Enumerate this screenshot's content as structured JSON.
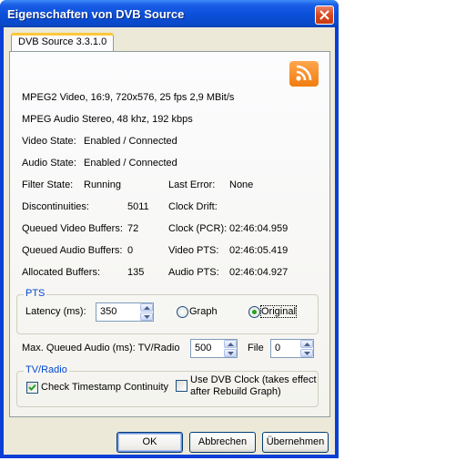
{
  "window": {
    "title": "Eigenschaften von DVB Source"
  },
  "tab": {
    "label": "DVB Source 3.3.1.0"
  },
  "info": {
    "video_format": "MPEG2 Video, 16:9, 720x576, 25 fps  2,9 MBit/s",
    "audio_format": "MPEG Audio Stereo, 48 khz, 192 kbps",
    "video_state_label": "Video State:",
    "video_state_value": "Enabled / Connected",
    "audio_state_label": "Audio State:",
    "audio_state_value": "Enabled / Connected"
  },
  "stats": {
    "filter_state_label": "Filter State:",
    "filter_state_value": "Running",
    "last_error_label": "Last Error:",
    "last_error_value": "None",
    "discontinuities_label": "Discontinuities:",
    "discontinuities_value": "5011",
    "clock_drift_label": "Clock Drift:",
    "queued_video_label": "Queued Video Buffers:",
    "queued_video_value": "72",
    "clock_pcr_label": "Clock (PCR):",
    "clock_pcr_value": "02:46:04.959",
    "queued_audio_label": "Queued Audio Buffers:",
    "queued_audio_value": "0",
    "video_pts_label": "Video PTS:",
    "video_pts_value": "02:46:05.419",
    "allocated_label": "Allocated Buffers:",
    "allocated_value": "135",
    "audio_pts_label": "Audio PTS:",
    "audio_pts_value": "02:46:04.927"
  },
  "pts": {
    "group_title": "PTS",
    "latency_label": "Latency (ms):",
    "latency_value": "350",
    "radio_graph": "Graph",
    "radio_original": "Original",
    "selected": "Original"
  },
  "queue": {
    "label": "Max. Queued Audio (ms): TV/Radio",
    "tv_radio_value": "500",
    "file_label": "File",
    "file_value": "0"
  },
  "tvradio": {
    "group_title": "TV/Radio",
    "check_timestamp_label": "Check Timestamp Continuity",
    "check_timestamp_checked": true,
    "dvb_clock_label_line1": "Use DVB Clock (takes effect",
    "dvb_clock_label_line2": "after Rebuild Graph)",
    "dvb_clock_checked": false
  },
  "buttons": {
    "ok": "OK",
    "cancel": "Abbrechen",
    "apply": "Übernehmen"
  },
  "colors": {
    "titlebar": "#0b4fd9",
    "dialog_bg": "#ece9d8",
    "group_title": "#0046d5",
    "rss_icon": "#f07d10"
  }
}
